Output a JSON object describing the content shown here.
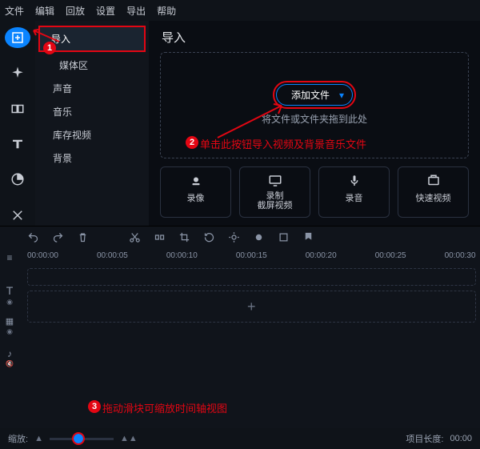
{
  "menu": {
    "file": "文件",
    "edit": "编辑",
    "playback": "回放",
    "settings": "设置",
    "export": "导出",
    "help": "帮助"
  },
  "sidebar": {
    "import": "导入",
    "media": "媒体区",
    "sound": "声音",
    "music": "音乐",
    "stock": "库存视频",
    "bg": "背景"
  },
  "content": {
    "title": "导入",
    "add_btn": "添加文件",
    "drop_hint": "将文件或文件夹拖到此处"
  },
  "actions": {
    "record_cam": "录像",
    "record_screen1": "录制",
    "record_screen2": "截屏视频",
    "record_audio": "录音",
    "quick_video": "快速视频"
  },
  "ruler": [
    "00:00:00",
    "00:00:05",
    "00:00:10",
    "00:00:15",
    "00:00:20",
    "00:00:25",
    "00:00:30"
  ],
  "footer": {
    "zoom_label": "缩放:",
    "project_len_label": "项目长度:",
    "project_len_value": "00:00"
  },
  "annotations": {
    "step2": "单击此按钮导入视频及背景音乐文件",
    "step3": "拖动滑块可缩放时间轴视图"
  }
}
